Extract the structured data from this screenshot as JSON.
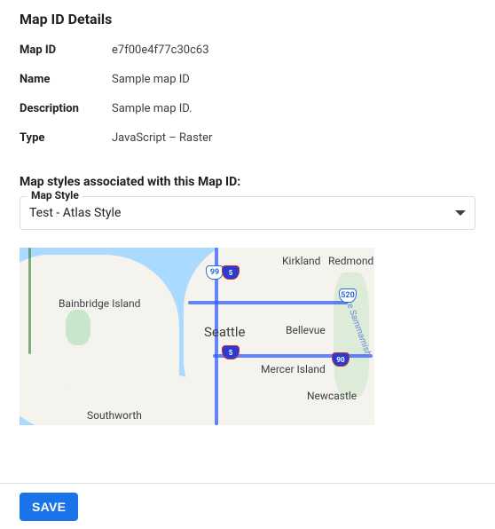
{
  "title": "Map ID Details",
  "details": {
    "map_id_label": "Map ID",
    "map_id_value": "e7f00e4f77c30c63",
    "name_label": "Name",
    "name_value": "Sample map ID",
    "description_label": "Description",
    "description_value": "Sample map ID.",
    "type_label": "Type",
    "type_value": "JavaScript – Raster"
  },
  "styles_heading": "Map styles associated with this Map ID:",
  "select": {
    "label": "Map Style",
    "value": "Test - Atlas Style"
  },
  "map_labels": {
    "kirkland": "Kirkland",
    "redmond": "Redmond",
    "seattle": "Seattle",
    "bellevue": "Bellevue",
    "bainbridge": "Bainbridge Island",
    "mercer": "Mercer Island",
    "newcastle": "Newcastle",
    "southworth": "Southworth",
    "sammamish": "Lake Sammamish",
    "s520": "520",
    "s99": "99",
    "i5": "5",
    "i90": "90"
  },
  "save_label": "SAVE"
}
